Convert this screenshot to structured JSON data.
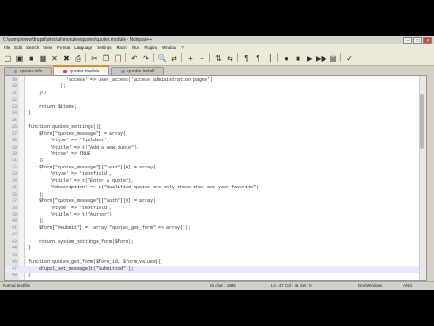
{
  "window": {
    "title": "C:\\wamp\\www\\drupal\\sites\\all\\modules\\quotes\\quotes.module - Notepad++",
    "controls": [
      "–",
      "□",
      "×"
    ]
  },
  "menu": [
    "File",
    "Edit",
    "Search",
    "View",
    "Format",
    "Language",
    "Settings",
    "Macro",
    "Run",
    "Plugins",
    "Window",
    "?"
  ],
  "toolbar_icons": [
    "new-file-icon",
    "open-file-icon",
    "save-icon",
    "save-all-icon",
    "close-file-icon",
    "close-all-icon",
    "print-icon",
    "separator",
    "cut-icon",
    "copy-icon",
    "paste-icon",
    "separator",
    "undo-icon",
    "redo-icon",
    "separator",
    "find-icon",
    "replace-icon",
    "separator",
    "zoom-in-icon",
    "zoom-out-icon",
    "separator",
    "sync-v-icon",
    "sync-h-icon",
    "separator",
    "word-wrap-icon",
    "all-chars-icon",
    "indent-guide-icon",
    "separator",
    "record-macro-icon",
    "stop-macro-icon",
    "play-macro-icon",
    "run-macro-multiple-icon",
    "save-macro-icon",
    "separator",
    "spell-check-icon"
  ],
  "toolbar_glyphs": [
    "▢",
    "▣",
    "■",
    "▦",
    "✕",
    "✖",
    "⎙",
    "",
    "✂",
    "❐",
    "📋",
    "",
    "↶",
    "↷",
    "",
    "🔍",
    "⇄",
    "",
    "+",
    "−",
    "",
    "⇅",
    "⇆",
    "",
    "¶",
    "¶",
    "║",
    "",
    "●",
    "■",
    "▶",
    "▶▶",
    "▤",
    "",
    "✓"
  ],
  "tabs": [
    {
      "label": "quotes.info",
      "active": false
    },
    {
      "label": "quotes.module",
      "active": true
    },
    {
      "label": "quotes.install",
      "active": false
    }
  ],
  "code_lines": [
    {
      "n": "19",
      "text": "              'access' => user_access('access administration pages')"
    },
    {
      "n": "20",
      "text": "            );"
    },
    {
      "n": "21",
      "text": "    }//"
    },
    {
      "n": "22",
      "text": ""
    },
    {
      "n": "23",
      "text": "    return $items;"
    },
    {
      "n": "24",
      "text": "}"
    },
    {
      "n": "25",
      "text": ""
    },
    {
      "n": "26",
      "text": "function quotes_settings(){"
    },
    {
      "n": "27",
      "text": "    $form[\"quotes_message\"] = array("
    },
    {
      "n": "28",
      "text": "        '#type' => 'fieldset',"
    },
    {
      "n": "29",
      "text": "        '#title' => t(\"Add a new quote\"),"
    },
    {
      "n": "30",
      "text": "        '#tree' => TRUE"
    },
    {
      "n": "31",
      "text": "    );"
    },
    {
      "n": "32",
      "text": "    $form[\"quotes_message\"][\"text\"][0] = array("
    },
    {
      "n": "33",
      "text": "        '#type' => 'textfield',"
    },
    {
      "n": "34",
      "text": "        '#title' => t(\"Enter a quote\"),"
    },
    {
      "n": "35",
      "text": "        '#description' => t(\"Qualified quotes are only those that are your favorite\")"
    },
    {
      "n": "36",
      "text": "    );"
    },
    {
      "n": "37",
      "text": "    $form[\"quotes_message\"][\"auth\"][0] = array("
    },
    {
      "n": "38",
      "text": "        '#type' => 'textfield',"
    },
    {
      "n": "39",
      "text": "        '#title' => t(\"Author\")"
    },
    {
      "n": "40",
      "text": "    );"
    },
    {
      "n": "41",
      "text": "    $form[\"#submit\"] =  array(\"quotes_get_form\" => array());"
    },
    {
      "n": "42",
      "text": ""
    },
    {
      "n": "43",
      "text": "    return system_settings_form($form);"
    },
    {
      "n": "44",
      "text": "}"
    },
    {
      "n": "45",
      "text": ""
    },
    {
      "n": "46",
      "text": "function quotes_get_form($form_id, $form_values){"
    },
    {
      "n": "47",
      "text": "    drupal_set_message(t(\"Submitted\"));",
      "current": true
    },
    {
      "n": "48",
      "text": "}"
    }
  ],
  "status": {
    "file_type": "Normal text file",
    "length": "nb char : 1686",
    "position": "Ln : 47   Col : 41   Sel : 0",
    "eol": "Dos\\Windows",
    "encoding": "ANSI"
  }
}
